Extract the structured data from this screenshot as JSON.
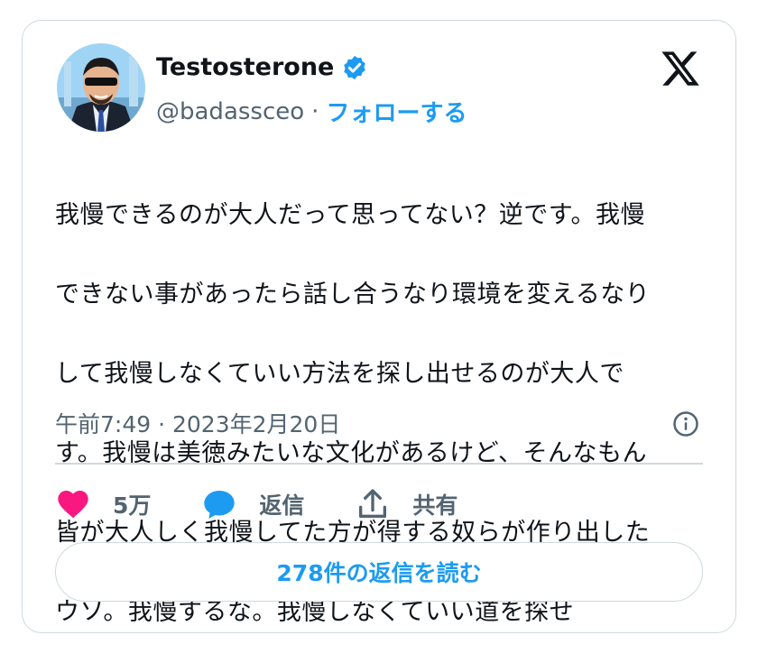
{
  "author": {
    "display_name": "Testosterone",
    "handle": "@badassceo",
    "separator": "·",
    "follow_label": "フォローする",
    "verified": true
  },
  "tweet": {
    "lines": [
      "我慢できるのが大人だって思ってない？逆です。我慢",
      "できない事があったら話し合うなり環境を変えるなり",
      "して我慢しなくていい方法を探し出せるのが大人で",
      "す。我慢は美徳みたいな文化があるけど、そんなもん",
      "皆が大人しく我慢してた方が得する奴らが作り出した",
      "ウソ。我慢するな。我慢しなくていい道を探せ"
    ],
    "timestamp": "午前7:49 · 2023年2月20日"
  },
  "actions": {
    "like_count": "5万",
    "reply_label": "返信",
    "share_label": "共有"
  },
  "read_replies_label": "278件の返信を読む",
  "icons": {
    "verified": "verified-badge-icon",
    "logo": "x-logo-icon",
    "info": "info-icon",
    "like": "heart-icon",
    "reply": "speech-bubble-icon",
    "share": "share-icon"
  },
  "colors": {
    "accent": "#1d9bf0",
    "like": "#f91880",
    "text": "#0f1419",
    "muted": "#536471",
    "border": "#cfd9de"
  }
}
